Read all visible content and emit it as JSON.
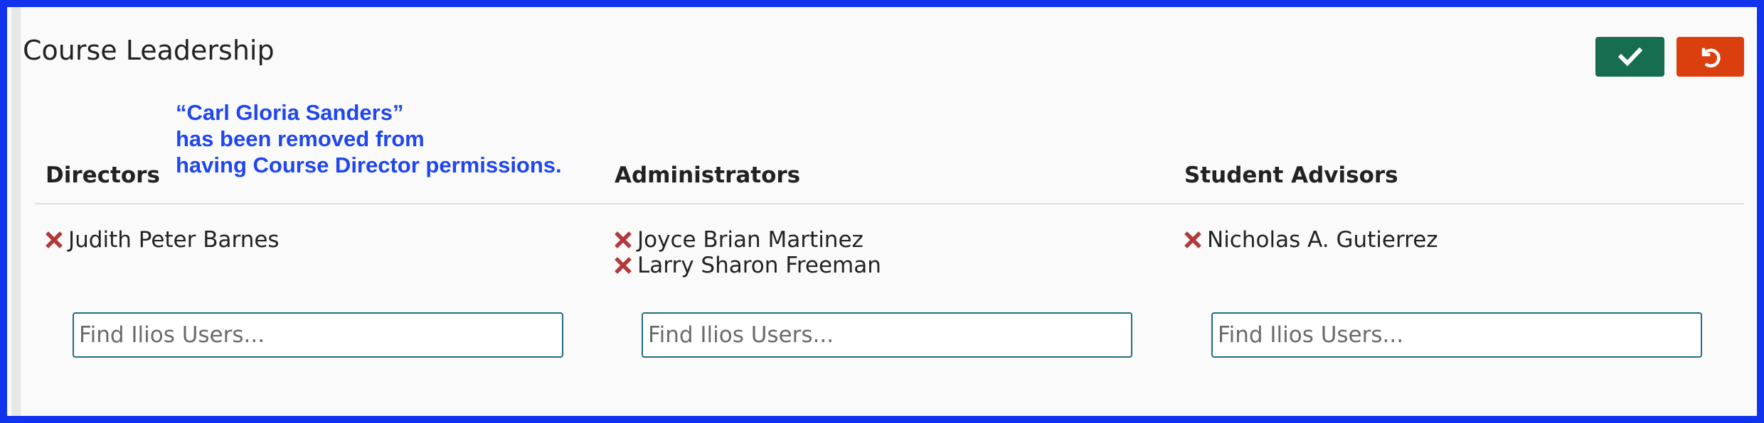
{
  "section": {
    "title": "Course Leadership",
    "annotation_lines": [
      "“Carl Gloria Sanders”",
      "has been removed from",
      "having Course Director permissions."
    ]
  },
  "actions": {
    "save_icon": "check-icon",
    "cancel_icon": "undo-icon",
    "save_color": "#176d50",
    "cancel_color": "#dc3f0e"
  },
  "columns": [
    {
      "header": "Directors",
      "users": [
        "Judith Peter Barnes"
      ],
      "search_placeholder": "Find Ilios Users..."
    },
    {
      "header": "Administrators",
      "users": [
        "Joyce Brian Martinez",
        "Larry Sharon Freeman"
      ],
      "search_placeholder": "Find Ilios Users..."
    },
    {
      "header": "Student Advisors",
      "users": [
        "Nicholas A. Gutierrez"
      ],
      "search_placeholder": "Find Ilios Users..."
    }
  ],
  "colors": {
    "frame_border": "#1133ee",
    "annotation_text": "#1f46ef",
    "remove_icon": "#b23a3a",
    "input_border": "#216d80"
  }
}
